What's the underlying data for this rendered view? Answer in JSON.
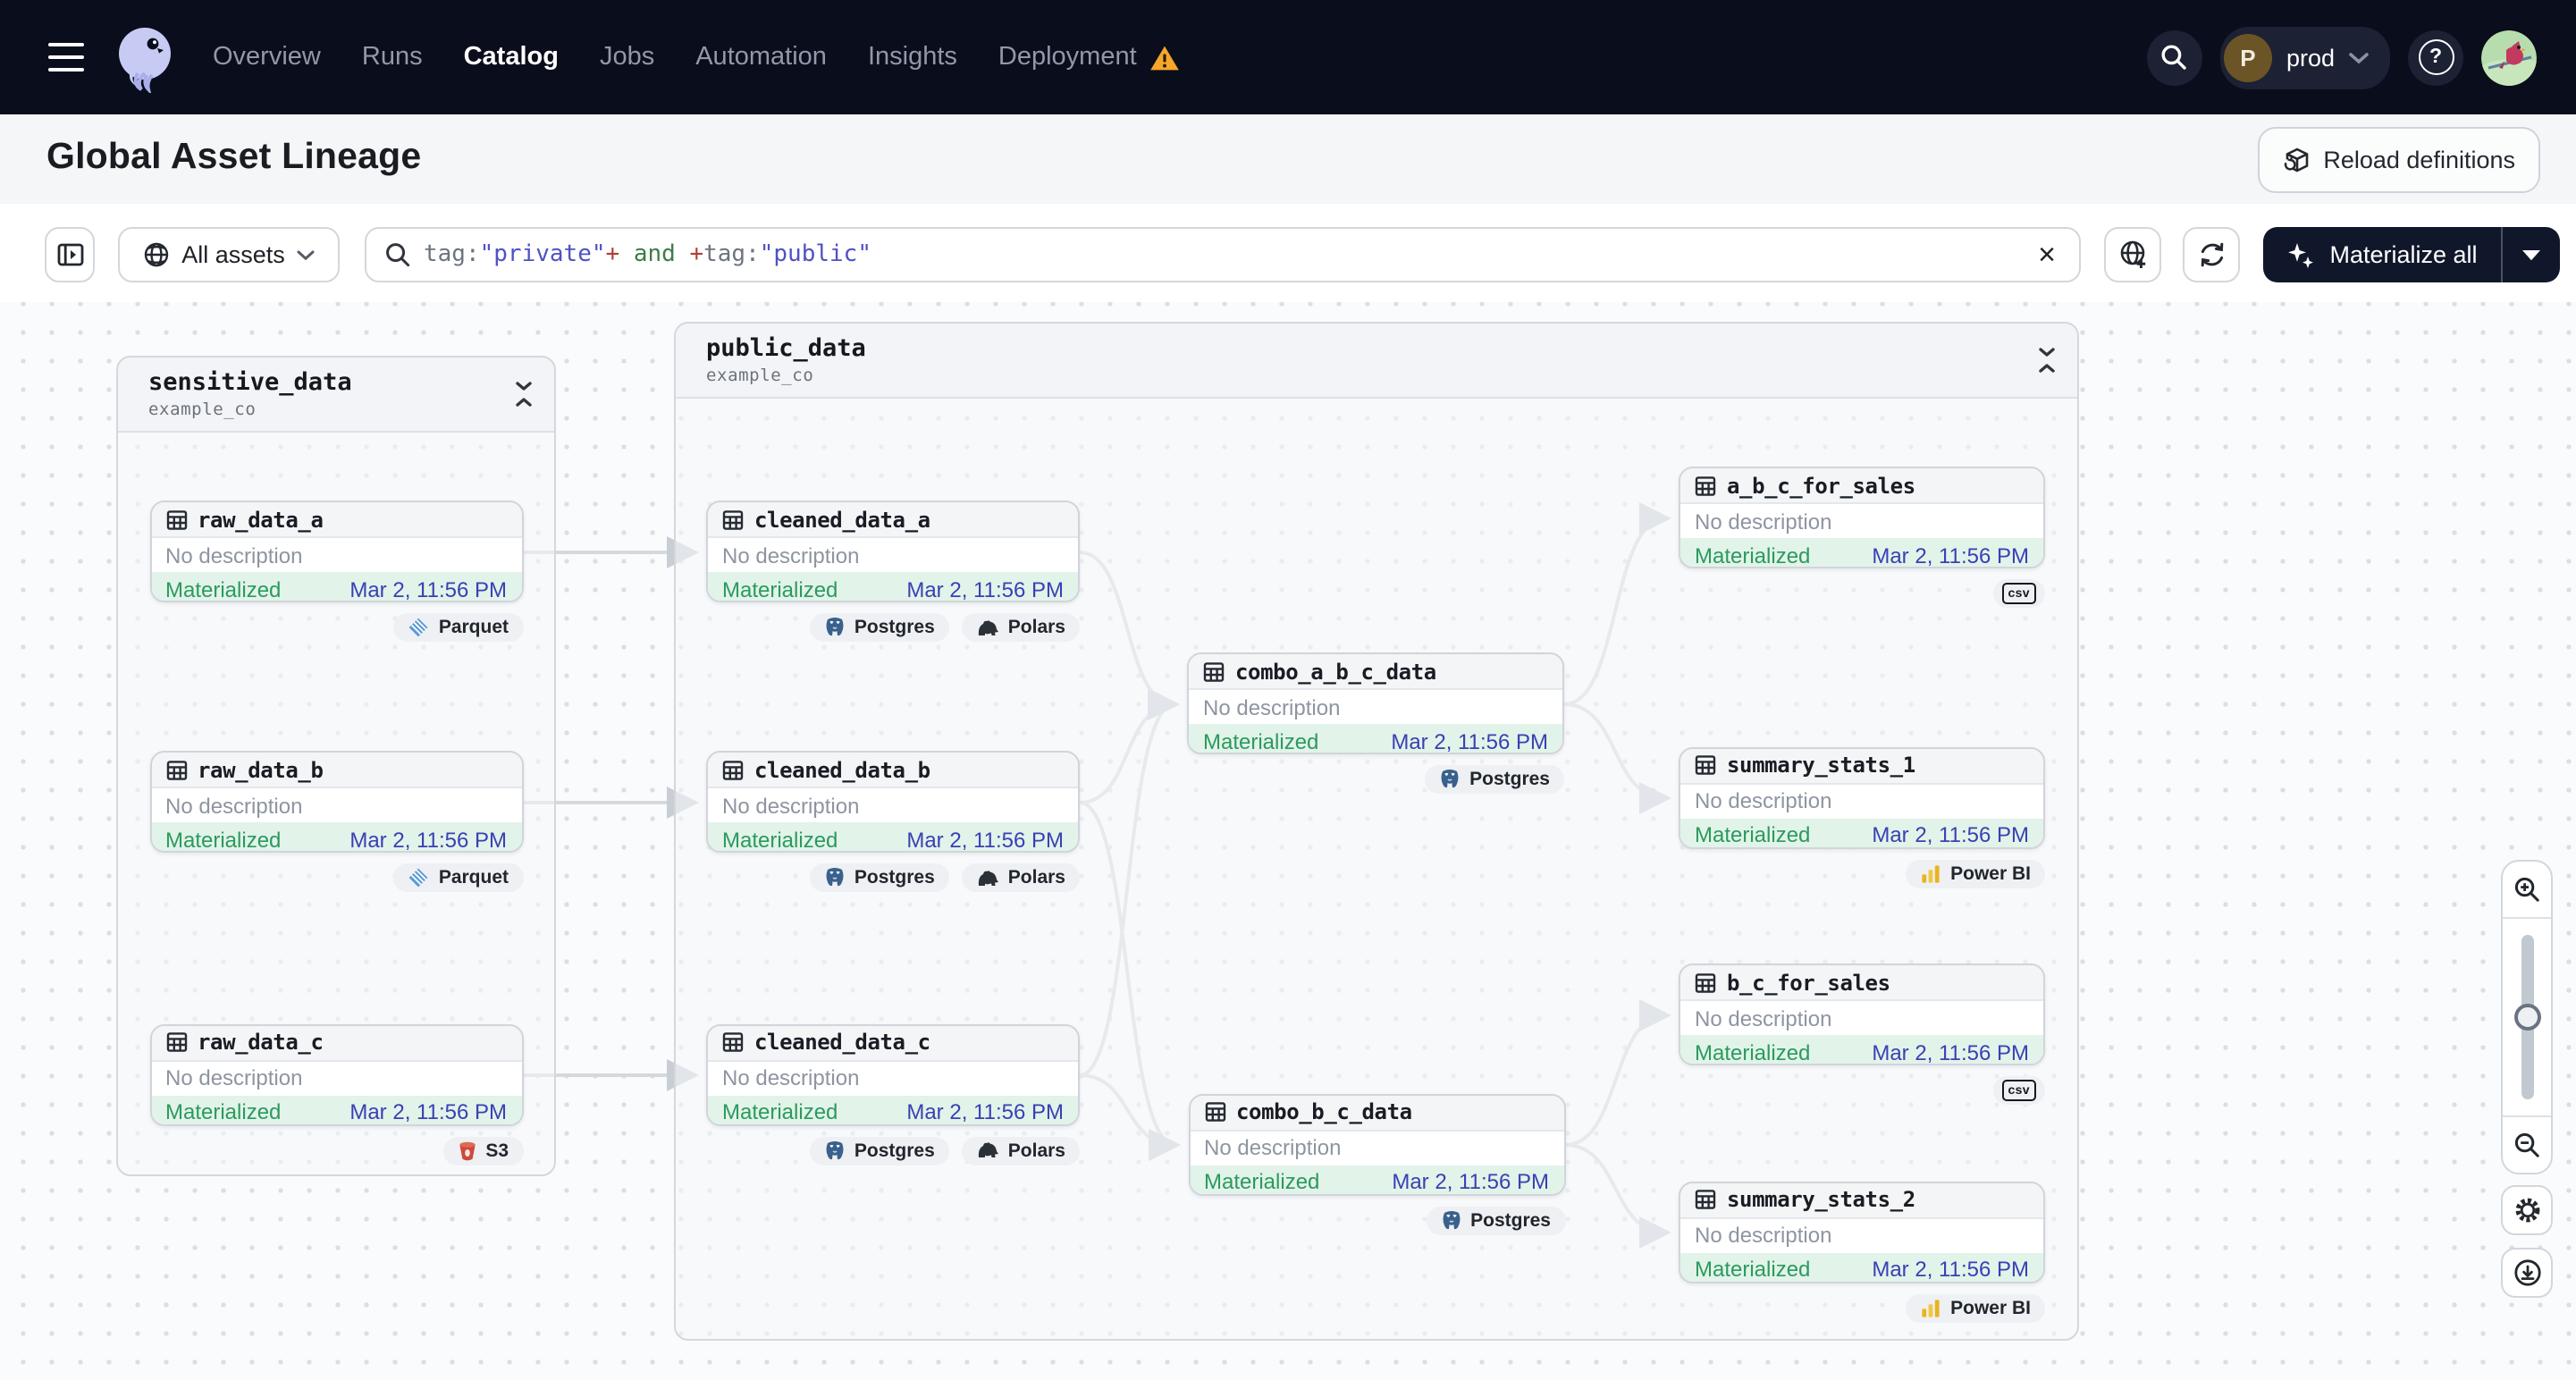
{
  "nav": {
    "items": [
      {
        "label": "Overview",
        "active": false
      },
      {
        "label": "Runs",
        "active": false
      },
      {
        "label": "Catalog",
        "active": true
      },
      {
        "label": "Jobs",
        "active": false
      },
      {
        "label": "Automation",
        "active": false
      },
      {
        "label": "Insights",
        "active": false
      },
      {
        "label": "Deployment",
        "active": false,
        "warning": true
      }
    ],
    "environment": {
      "initial": "P",
      "name": "prod"
    }
  },
  "header": {
    "title": "Global Asset Lineage",
    "reload_label": "Reload definitions"
  },
  "toolbar": {
    "scope_label": "All assets",
    "query_segments": [
      {
        "text": "tag:",
        "type": "plain"
      },
      {
        "text": "\"private\"",
        "type": "value"
      },
      {
        "text": "+",
        "type": "op"
      },
      {
        "text": " and ",
        "type": "bool"
      },
      {
        "text": "+",
        "type": "op"
      },
      {
        "text": "tag:",
        "type": "plain"
      },
      {
        "text": "\"public\"",
        "type": "value"
      }
    ],
    "clear_label": "×",
    "materialize_label": "Materialize all"
  },
  "graph": {
    "groups": [
      {
        "id": "sensitive_data",
        "title": "sensitive_data",
        "subtitle": "example_co"
      },
      {
        "id": "public_data",
        "title": "public_data",
        "subtitle": "example_co"
      }
    ],
    "nodes": [
      {
        "id": "raw_data_a",
        "group": "sensitive_data",
        "name": "raw_data_a",
        "description": "No description",
        "status": "Materialized",
        "timestamp": "Mar 2, 11:56 PM",
        "tags": [
          {
            "label": "Parquet",
            "icon": "parquet-icon"
          }
        ]
      },
      {
        "id": "raw_data_b",
        "group": "sensitive_data",
        "name": "raw_data_b",
        "description": "No description",
        "status": "Materialized",
        "timestamp": "Mar 2, 11:56 PM",
        "tags": [
          {
            "label": "Parquet",
            "icon": "parquet-icon"
          }
        ]
      },
      {
        "id": "raw_data_c",
        "group": "sensitive_data",
        "name": "raw_data_c",
        "description": "No description",
        "status": "Materialized",
        "timestamp": "Mar 2, 11:56 PM",
        "tags": [
          {
            "label": "S3",
            "icon": "s3-icon"
          }
        ]
      },
      {
        "id": "cleaned_data_a",
        "group": "public_data",
        "name": "cleaned_data_a",
        "description": "No description",
        "status": "Materialized",
        "timestamp": "Mar 2, 11:56 PM",
        "tags": [
          {
            "label": "Postgres",
            "icon": "postgres-icon"
          },
          {
            "label": "Polars",
            "icon": "polars-icon"
          }
        ]
      },
      {
        "id": "cleaned_data_b",
        "group": "public_data",
        "name": "cleaned_data_b",
        "description": "No description",
        "status": "Materialized",
        "timestamp": "Mar 2, 11:56 PM",
        "tags": [
          {
            "label": "Postgres",
            "icon": "postgres-icon"
          },
          {
            "label": "Polars",
            "icon": "polars-icon"
          }
        ]
      },
      {
        "id": "cleaned_data_c",
        "group": "public_data",
        "name": "cleaned_data_c",
        "description": "No description",
        "status": "Materialized",
        "timestamp": "Mar 2, 11:56 PM",
        "tags": [
          {
            "label": "Postgres",
            "icon": "postgres-icon"
          },
          {
            "label": "Polars",
            "icon": "polars-icon"
          }
        ]
      },
      {
        "id": "combo_a_b_c_data",
        "group": "public_data",
        "name": "combo_a_b_c_data",
        "description": "No description",
        "status": "Materialized",
        "timestamp": "Mar 2, 11:56 PM",
        "tags": [
          {
            "label": "Postgres",
            "icon": "postgres-icon"
          }
        ]
      },
      {
        "id": "combo_b_c_data",
        "group": "public_data",
        "name": "combo_b_c_data",
        "description": "No description",
        "status": "Materialized",
        "timestamp": "Mar 2, 11:56 PM",
        "tags": [
          {
            "label": "Postgres",
            "icon": "postgres-icon"
          }
        ]
      },
      {
        "id": "a_b_c_for_sales",
        "group": "public_data",
        "name": "a_b_c_for_sales",
        "description": "No description",
        "status": "Materialized",
        "timestamp": "Mar 2, 11:56 PM",
        "tags": [],
        "badge": "csv"
      },
      {
        "id": "summary_stats_1",
        "group": "public_data",
        "name": "summary_stats_1",
        "description": "No description",
        "status": "Materialized",
        "timestamp": "Mar 2, 11:56 PM",
        "tags": [
          {
            "label": "Power BI",
            "icon": "powerbi-icon"
          }
        ]
      },
      {
        "id": "b_c_for_sales",
        "group": "public_data",
        "name": "b_c_for_sales",
        "description": "No description",
        "status": "Materialized",
        "timestamp": "Mar 2, 11:56 PM",
        "tags": [],
        "badge": "csv"
      },
      {
        "id": "summary_stats_2",
        "group": "public_data",
        "name": "summary_stats_2",
        "description": "No description",
        "status": "Materialized",
        "timestamp": "Mar 2, 11:56 PM",
        "tags": [
          {
            "label": "Power BI",
            "icon": "powerbi-icon"
          }
        ]
      }
    ],
    "edges": [
      [
        "raw_data_a",
        "cleaned_data_a"
      ],
      [
        "raw_data_b",
        "cleaned_data_b"
      ],
      [
        "raw_data_c",
        "cleaned_data_c"
      ],
      [
        "cleaned_data_a",
        "combo_a_b_c_data"
      ],
      [
        "cleaned_data_b",
        "combo_a_b_c_data"
      ],
      [
        "cleaned_data_c",
        "combo_a_b_c_data"
      ],
      [
        "cleaned_data_b",
        "combo_b_c_data"
      ],
      [
        "cleaned_data_c",
        "combo_b_c_data"
      ],
      [
        "combo_a_b_c_data",
        "a_b_c_for_sales"
      ],
      [
        "combo_a_b_c_data",
        "summary_stats_1"
      ],
      [
        "combo_b_c_data",
        "b_c_for_sales"
      ],
      [
        "combo_b_c_data",
        "summary_stats_2"
      ]
    ]
  },
  "colors": {
    "navbar_bg": "#0a0d1c",
    "accent_dark_button": "#11172b",
    "status_green": "#2b9a5e",
    "timestamp_indigo": "#3a40b4",
    "warning_orange": "#f5a62b",
    "edge_gray": "#d5d9de"
  }
}
